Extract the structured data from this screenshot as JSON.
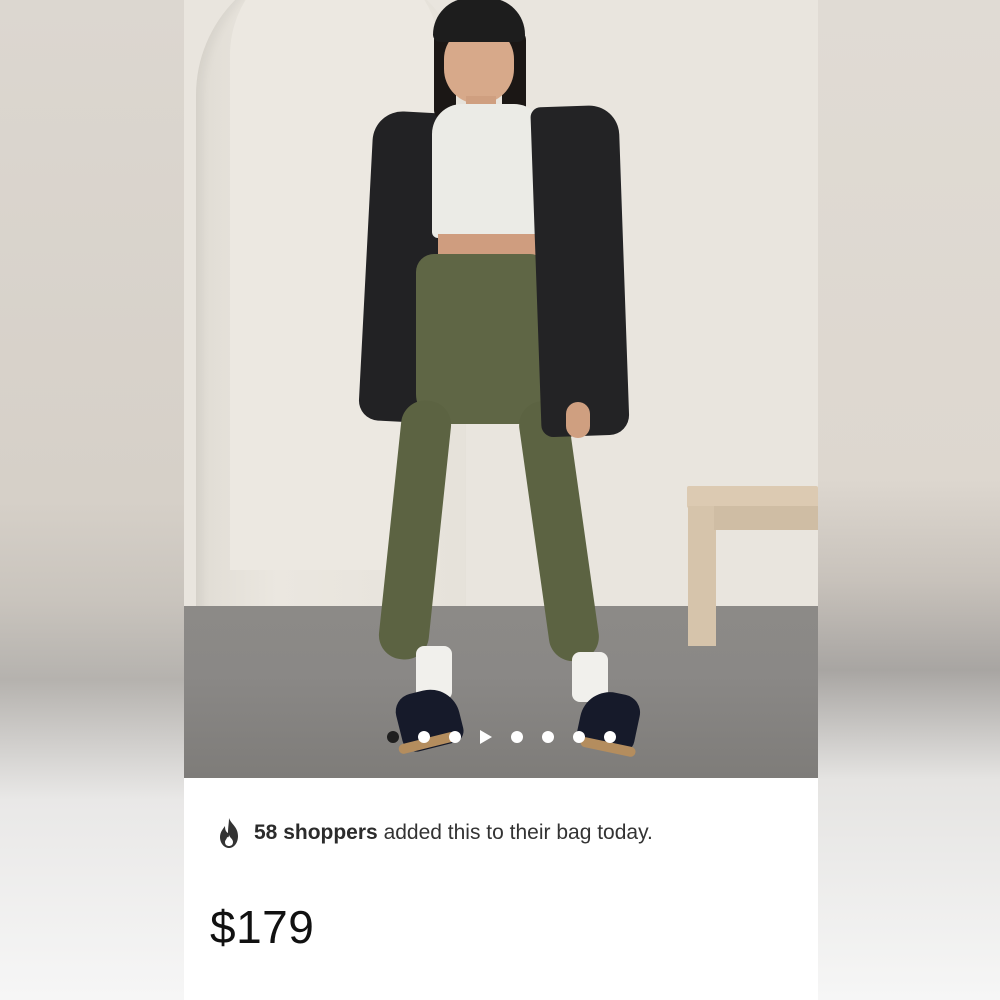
{
  "product": {
    "image_alt_icon": "product-photo",
    "pager": {
      "dot_count": 7,
      "active_index": 0,
      "video_marker_after": 2
    }
  },
  "social_proof": {
    "icon": "flame-icon",
    "count_text": "58 shoppers",
    "message": "added this to their bag today."
  },
  "price": {
    "amount": "$179"
  },
  "colors": {
    "flame": "#333333",
    "price_text": "#111111",
    "active_dot": "#1f1f1f",
    "inactive_dot": "#ffffff"
  }
}
